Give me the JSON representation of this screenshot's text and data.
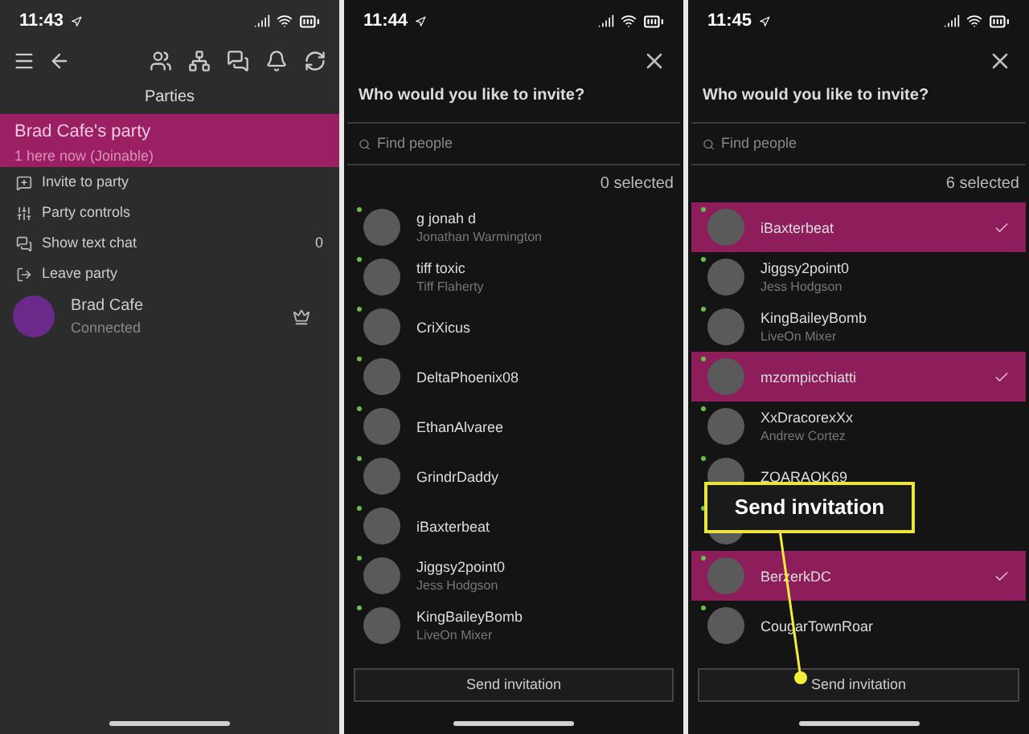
{
  "screens": [
    {
      "kind": "party",
      "status_time": "11:43",
      "title": "Parties",
      "party": {
        "name": "Brad Cafe's party",
        "status": "1 here now (Joinable)",
        "selected": true
      },
      "menu": [
        {
          "kind": "invite",
          "label": "Invite to party"
        },
        {
          "kind": "controls",
          "label": "Party controls"
        },
        {
          "kind": "chat",
          "label": "Show text chat",
          "count": "0"
        },
        {
          "kind": "leave",
          "label": "Leave party"
        }
      ],
      "member": {
        "name": "Brad Cafe",
        "status": "Connected"
      }
    },
    {
      "kind": "invite",
      "status_time": "11:44",
      "title": "Who would you like to invite?",
      "search": {
        "placeholder": "Find people"
      },
      "selected_count": "0 selected",
      "people": [
        {
          "gamertag": "g jonah d",
          "real_name": "Jonathan Warmington",
          "selected": false
        },
        {
          "gamertag": "tiff toxic",
          "real_name": "Tiff Flaherty",
          "selected": false
        },
        {
          "gamertag": "CriXicus",
          "selected": false
        },
        {
          "gamertag": "DeltaPhoenix08",
          "selected": false
        },
        {
          "gamertag": "EthanAlvaree",
          "selected": false
        },
        {
          "gamertag": "GrindrDaddy",
          "selected": false
        },
        {
          "gamertag": "iBaxterbeat",
          "selected": false
        },
        {
          "gamertag": "Jiggsy2point0",
          "real_name": "Jess Hodgson",
          "selected": false
        },
        {
          "gamertag": "KingBaileyBomb",
          "real_name": "LiveOn Mixer",
          "selected": false
        }
      ],
      "button": "Send invitation"
    },
    {
      "kind": "invite",
      "status_time": "11:45",
      "title": "Who would you like to invite?",
      "search": {
        "placeholder": "Find people"
      },
      "selected_count": "6 selected",
      "people": [
        {
          "gamertag": "iBaxterbeat",
          "selected": true
        },
        {
          "gamertag": "Jiggsy2point0",
          "real_name": "Jess Hodgson",
          "selected": false
        },
        {
          "gamertag": "KingBaileyBomb",
          "real_name": "LiveOn Mixer",
          "selected": false
        },
        {
          "gamertag": "mzompicchiatti",
          "selected": true
        },
        {
          "gamertag": "XxDracorexXx",
          "real_name": "Andrew Cortez",
          "selected": false
        },
        {
          "gamertag": "ZOARAOK69",
          "selected": false
        },
        {
          "selected": false
        },
        {
          "gamertag": "BerzerkDC",
          "selected": true
        },
        {
          "gamertag": "CougarTownRoar",
          "selected": false
        }
      ],
      "button": "Send invitation",
      "callout": "Send invitation"
    }
  ]
}
